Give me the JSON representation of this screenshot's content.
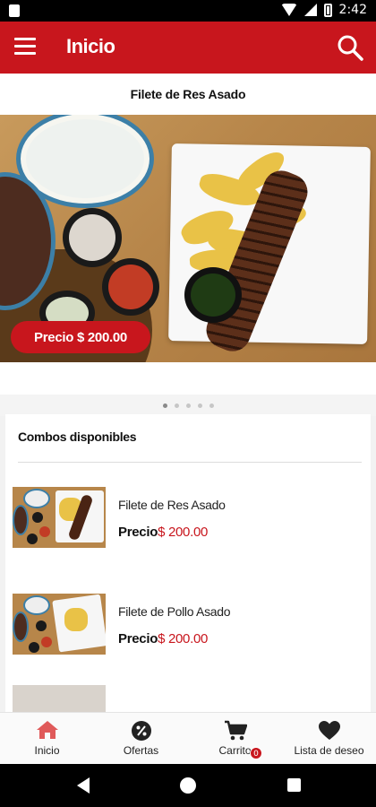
{
  "status_bar": {
    "time": "2:42"
  },
  "app_bar": {
    "title": "Inicio",
    "menu_icon": "hamburger-menu-icon",
    "search_icon": "search-icon",
    "color": "#c8161d"
  },
  "banner": {
    "title": "Filete de Res Asado",
    "price_label": "Precio  $ 200.00",
    "slides_total": 5,
    "active_slide": 1
  },
  "combos": {
    "title": "Combos disponibles",
    "items": [
      {
        "name": "Filete de Res Asado",
        "price_label": "Precio",
        "price": "$ 200.00"
      },
      {
        "name": "Filete de Pollo Asado",
        "price_label": "Precio",
        "price": "$ 200.00"
      }
    ]
  },
  "bottom_nav": {
    "items": [
      {
        "label": "Inicio",
        "icon": "home-icon",
        "active": true
      },
      {
        "label": "Ofertas",
        "icon": "percent-badge-icon"
      },
      {
        "label": "Carrito",
        "icon": "cart-icon"
      },
      {
        "label": "Lista de deseo",
        "icon": "heart-icon"
      }
    ],
    "cart_badge": "0"
  }
}
